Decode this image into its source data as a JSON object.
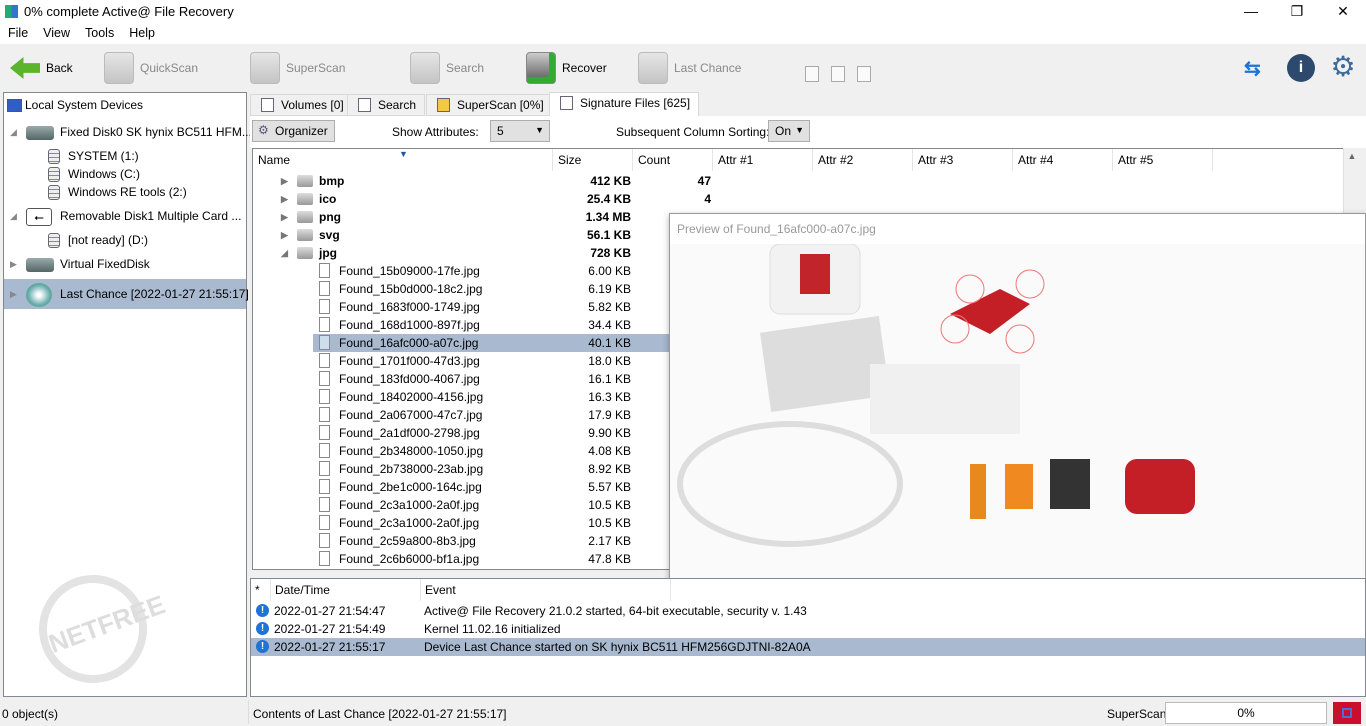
{
  "window": {
    "title": "0% complete Active@ File Recovery",
    "minimize": "—",
    "maximize": "❐",
    "close": "✕"
  },
  "menu": [
    "File",
    "View",
    "Tools",
    "Help"
  ],
  "toolbar": {
    "back": "Back",
    "quickscan": "QuickScan",
    "superscan": "SuperScan",
    "search": "Search",
    "recover": "Recover",
    "last_chance": "Last Chance"
  },
  "tree": {
    "root": "Local System Devices",
    "items": [
      {
        "label": "Fixed Disk0 SK hynix BC511 HFM..."
      },
      {
        "label": "SYSTEM (1:)"
      },
      {
        "label": "Windows (C:)"
      },
      {
        "label": "Windows RE tools (2:)"
      },
      {
        "label": "Removable Disk1 Multiple Card  ..."
      },
      {
        "label": "[not ready] (D:)"
      },
      {
        "label": "Virtual FixedDisk"
      },
      {
        "label": "Last Chance [2022-01-27 21:55:17]"
      }
    ]
  },
  "watermark": {
    "text": "NETFREE"
  },
  "tabs": [
    "Volumes [0]",
    "Search",
    "SuperScan [0%]",
    "Signature Files [625]"
  ],
  "options": {
    "organizer": "Organizer",
    "show_attributes_label": "Show Attributes:",
    "show_attributes_value": "5",
    "sorting_label": "Subsequent Column Sorting:",
    "sorting_value": "On"
  },
  "columns": [
    "Name",
    "Size",
    "Count",
    "Attr #1",
    "Attr #2",
    "Attr #3",
    "Attr #4",
    "Attr #5"
  ],
  "folders": [
    {
      "name": "bmp",
      "size": "412 KB",
      "count": "47"
    },
    {
      "name": "ico",
      "size": "25.4 KB",
      "count": "4"
    },
    {
      "name": "png",
      "size": "1.34 MB",
      "count": ""
    },
    {
      "name": "svg",
      "size": "56.1 KB",
      "count": ""
    },
    {
      "name": "jpg",
      "size": "728 KB",
      "count": ""
    }
  ],
  "files": [
    {
      "name": "Found_15b09000-17fe.jpg",
      "size": "6.00 KB"
    },
    {
      "name": "Found_15b0d000-18c2.jpg",
      "size": "6.19 KB"
    },
    {
      "name": "Found_1683f000-1749.jpg",
      "size": "5.82 KB"
    },
    {
      "name": "Found_168d1000-897f.jpg",
      "size": "34.4 KB"
    },
    {
      "name": "Found_16afc000-a07c.jpg",
      "size": "40.1 KB"
    },
    {
      "name": "Found_1701f000-47d3.jpg",
      "size": "18.0 KB"
    },
    {
      "name": "Found_183fd000-4067.jpg",
      "size": "16.1 KB"
    },
    {
      "name": "Found_18402000-4156.jpg",
      "size": "16.3 KB"
    },
    {
      "name": "Found_2a067000-47c7.jpg",
      "size": "17.9 KB"
    },
    {
      "name": "Found_2a1df000-2798.jpg",
      "size": "9.90 KB"
    },
    {
      "name": "Found_2b348000-1050.jpg",
      "size": "4.08 KB"
    },
    {
      "name": "Found_2b738000-23ab.jpg",
      "size": "8.92 KB"
    },
    {
      "name": "Found_2be1c000-164c.jpg",
      "size": "5.57 KB"
    },
    {
      "name": "Found_2c3a1000-2a0f.jpg",
      "size": "10.5 KB"
    },
    {
      "name": "Found_2c3a1000-2a0f.jpg",
      "size": "10.5 KB"
    },
    {
      "name": "Found_2c59a800-8b3.jpg",
      "size": "2.17 KB"
    },
    {
      "name": "Found_2c6b6000-bf1a.jpg",
      "size": "47.8 KB"
    }
  ],
  "selected_file_index": 4,
  "preview": {
    "title": "Preview of Found_16afc000-a07c.jpg"
  },
  "log": {
    "columns": [
      "*",
      "Date/Time",
      "Event"
    ],
    "rows": [
      {
        "time": "2022-01-27 21:54:47",
        "event": "Active@ File Recovery 21.0.2 started, 64-bit executable, security v. 1.43"
      },
      {
        "time": "2022-01-27 21:54:49",
        "event": "Kernel 11.02.16 initialized"
      },
      {
        "time": "2022-01-27 21:55:17",
        "event": "Device Last Chance started on SK hynix BC511 HFM256GDJTNI-82A0A"
      }
    ]
  },
  "status": {
    "objects": "0 object(s)",
    "contents": "Contents of Last Chance [2022-01-27 21:55:17]",
    "scan_label": "SuperScan",
    "progress": "0%"
  },
  "colors": {
    "selection": "#a9b9cf",
    "stop": "#c8102e",
    "info": "#1e73d8"
  }
}
